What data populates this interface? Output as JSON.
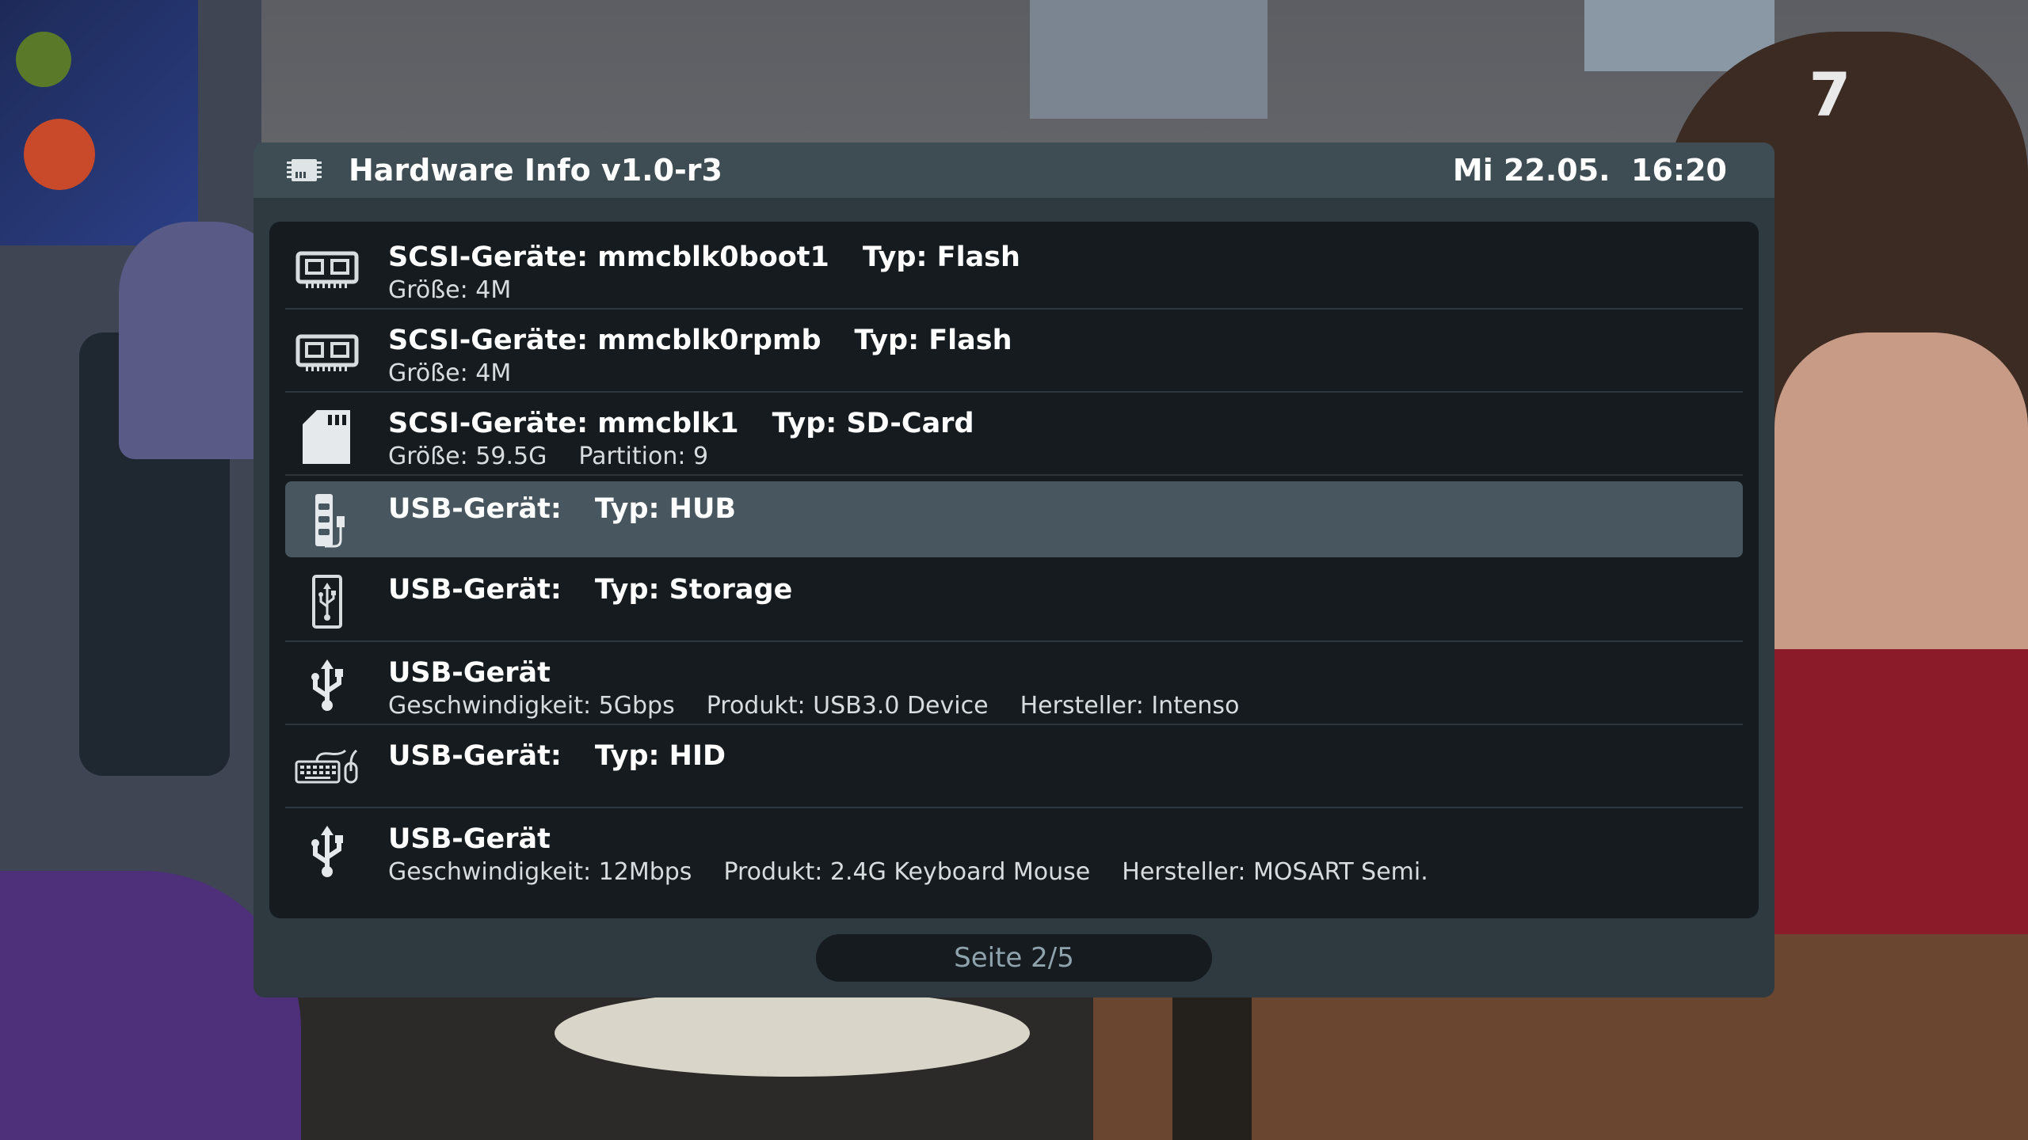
{
  "header": {
    "title": "Hardware Info v1.0-r3",
    "clock": "Mi 22.05.  16:20"
  },
  "channel_logo": "7",
  "rows": [
    {
      "icon": "memory-chip-icon",
      "name": "SCSI-Geräte: mmcblk0boot1",
      "type": "Typ: Flash",
      "details": [
        "Größe: 4M"
      ]
    },
    {
      "icon": "memory-chip-icon",
      "name": "SCSI-Geräte: mmcblk0rpmb",
      "type": "Typ: Flash",
      "details": [
        "Größe: 4M"
      ]
    },
    {
      "icon": "sd-card-icon",
      "name": "SCSI-Geräte: mmcblk1",
      "type": "Typ: SD-Card",
      "details": [
        "Größe: 59.5G",
        "Partition: 9"
      ]
    },
    {
      "icon": "usb-hub-icon",
      "name": "USB-Gerät:",
      "type": "Typ: HUB",
      "details": [],
      "selected": true
    },
    {
      "icon": "usb-storage-icon",
      "name": "USB-Gerät:",
      "type": "Typ: Storage",
      "details": []
    },
    {
      "icon": "usb-icon",
      "name": "USB-Gerät",
      "type": "",
      "details": [
        "Geschwindigkeit: 5Gbps",
        "Produkt: USB3.0 Device",
        "Hersteller: Intenso"
      ]
    },
    {
      "icon": "keyboard-mouse-icon",
      "name": "USB-Gerät:",
      "type": "Typ: HID",
      "details": []
    },
    {
      "icon": "usb-icon",
      "name": "USB-Gerät",
      "type": "",
      "details": [
        "Geschwindigkeit: 12Mbps",
        "Produkt: 2.4G Keyboard Mouse",
        "Hersteller: MOSART Semi."
      ]
    }
  ],
  "footer": {
    "page_label": "Seite 2/5"
  },
  "colors": {
    "window_bg": "#2f3a40",
    "title_bar": "#3e4c54",
    "list_bg": "#151b1f",
    "selection": "#47565f",
    "page_text": "#8fa3ad"
  }
}
